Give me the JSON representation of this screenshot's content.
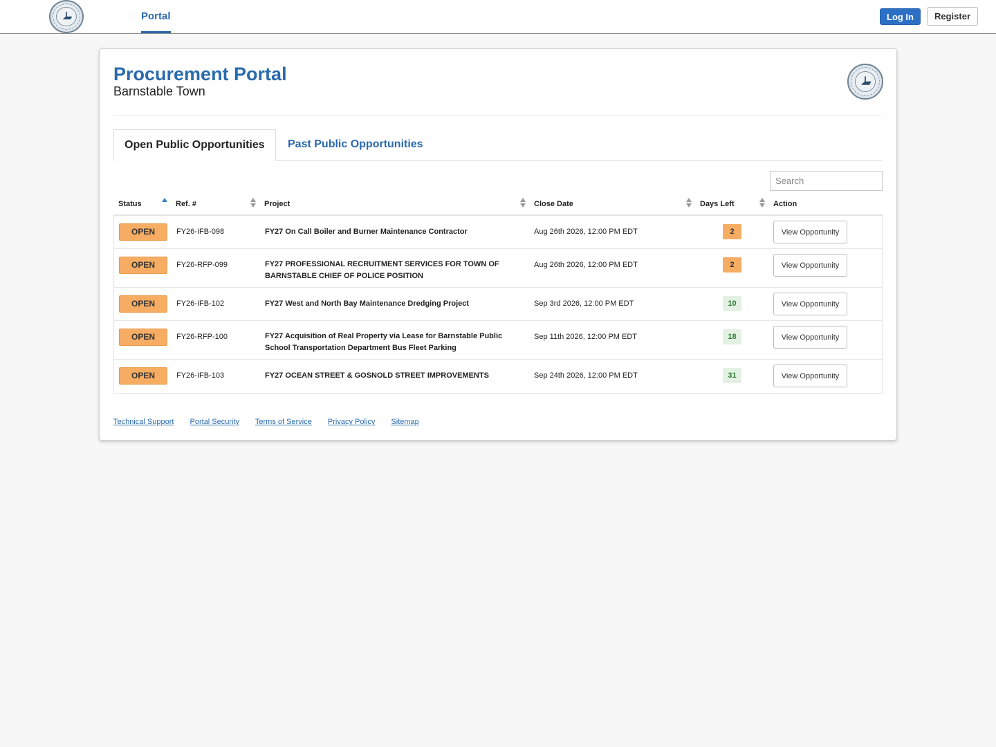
{
  "nav": {
    "portal_tab": "Portal",
    "login_label": "Log In",
    "register_label": "Register"
  },
  "header": {
    "title": "Procurement Portal",
    "subtitle": "Barnstable Town"
  },
  "tabs": {
    "open": "Open Public Opportunities",
    "past": "Past Public Opportunities"
  },
  "search": {
    "placeholder": "Search"
  },
  "table": {
    "headers": {
      "status": "Status",
      "ref": "Ref. #",
      "project": "Project",
      "close_date": "Close Date",
      "days_left": "Days Left",
      "action": "Action"
    },
    "rows": [
      {
        "status": "OPEN",
        "ref": "FY26-IFB-098",
        "project": "FY27 On Call Boiler and Burner Maintenance Contractor",
        "close_date": "Aug 26th 2026, 12:00 PM EDT",
        "days_left": "2",
        "action": "View Opportunity"
      },
      {
        "status": "OPEN",
        "ref": "FY26-RFP-099",
        "project": "FY27 PROFESSIONAL RECRUITMENT SERVICES FOR TOWN OF BARNSTABLE CHIEF OF POLICE POSITION",
        "close_date": "Aug 26th 2026, 12:00 PM EDT",
        "days_left": "2",
        "action": "View Opportunity"
      },
      {
        "status": "OPEN",
        "ref": "FY26-IFB-102",
        "project": "FY27 West and North Bay Maintenance Dredging Project",
        "close_date": "Sep 3rd 2026, 12:00 PM EDT",
        "days_left": "10",
        "action": "View Opportunity"
      },
      {
        "status": "OPEN",
        "ref": "FY26-RFP-100",
        "project": "FY27 Acquisition of Real Property via Lease for Barnstable Public School Transportation Department Bus Fleet Parking",
        "close_date": "Sep 11th 2026, 12:00 PM EDT",
        "days_left": "18",
        "action": "View Opportunity"
      },
      {
        "status": "OPEN",
        "ref": "FY26-IFB-103",
        "project": "FY27 OCEAN STREET & GOSNOLD STREET IMPROVEMENTS",
        "close_date": "Sep 24th 2026, 12:00 PM EDT",
        "days_left": "31",
        "action": "View Opportunity"
      }
    ]
  },
  "footer": {
    "links": [
      "Technical Support",
      "Portal Security",
      "Terms of Service",
      "Privacy Policy",
      "Sitemap"
    ]
  },
  "colors": {
    "brand_blue": "#2a6aad",
    "login_blue": "#2c70c6",
    "open_badge": "#f6ad63",
    "days_ok_bg": "#e3f1e3",
    "days_ok_text": "#2e7d32"
  }
}
